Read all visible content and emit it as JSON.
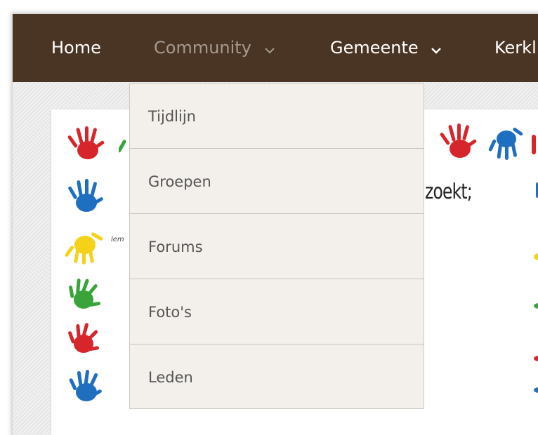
{
  "nav": {
    "items": [
      {
        "label": "Home",
        "has_dropdown": false,
        "active": false
      },
      {
        "label": "Community",
        "has_dropdown": true,
        "active": true
      },
      {
        "label": "Gemeente",
        "has_dropdown": true,
        "active": false
      },
      {
        "label": "Kerkl",
        "has_dropdown": false,
        "active": false
      }
    ]
  },
  "dropdown": {
    "items": [
      "Tijdlijn",
      "Groepen",
      "Forums",
      "Foto's",
      "Leden"
    ]
  },
  "card": {
    "headline_fragment": "zoekt;",
    "small_fragment": "lem"
  },
  "colors": {
    "navbar": "#4a3424",
    "nav_text": "#ffffff",
    "nav_active_text": "#a59a8f",
    "dropdown_bg": "#f3f0eb",
    "hand_red": "#d7262b",
    "hand_blue": "#1f6fc0",
    "hand_green": "#3aa43a",
    "hand_yellow": "#f4d21a"
  }
}
